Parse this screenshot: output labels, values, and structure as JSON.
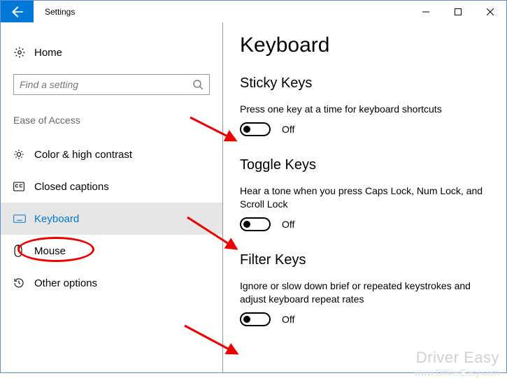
{
  "title_bar": {
    "app": "Settings"
  },
  "sidebar": {
    "home": "Home",
    "search_placeholder": "Find a setting",
    "section": "Ease of Access",
    "items": [
      {
        "label": "Color & high contrast"
      },
      {
        "label": "Closed captions"
      },
      {
        "label": "Keyboard"
      },
      {
        "label": "Mouse"
      },
      {
        "label": "Other options"
      }
    ]
  },
  "main": {
    "title": "Keyboard",
    "groups": [
      {
        "heading": "Sticky Keys",
        "desc": "Press one key at a time for keyboard shortcuts",
        "state": "Off"
      },
      {
        "heading": "Toggle Keys",
        "desc": "Hear a tone when you press Caps Lock, Num Lock, and Scroll Lock",
        "state": "Off"
      },
      {
        "heading": "Filter Keys",
        "desc": "Ignore or slow down brief or repeated keystrokes and adjust keyboard repeat rates",
        "state": "Off"
      }
    ]
  },
  "watermark": {
    "brand": "Driver Easy",
    "url": "www.DriverEasy.com"
  }
}
